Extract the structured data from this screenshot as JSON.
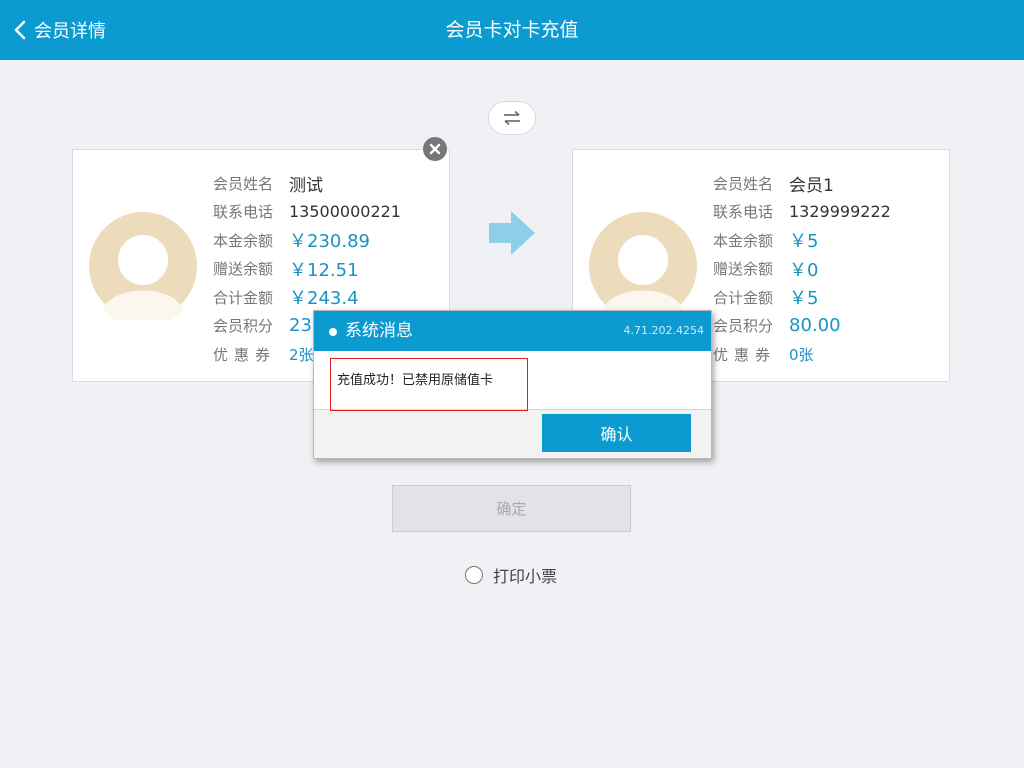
{
  "header": {
    "back_label": "会员详情",
    "title": "会员卡对卡充值"
  },
  "colors": {
    "primary": "#0b9bd0",
    "value_blue": "#1a93c4",
    "arrow": "#8ecfe8",
    "highlight_red": "#e02020"
  },
  "source_card": {
    "name_label": "会员姓名",
    "name": "测试",
    "phone_label": "联系电话",
    "phone": "13500000221",
    "principal_label": "本金余额",
    "principal": "￥230.89",
    "bonus_label": "赠送余额",
    "bonus": "￥12.51",
    "total_label": "合计金额",
    "total": "￥243.4",
    "points_label": "会员积分",
    "points": "23",
    "coupon_label": "优惠券",
    "coupons": "2张"
  },
  "target_card": {
    "name_label": "会员姓名",
    "name": "会员1",
    "phone_label": "联系电话",
    "phone": "1329999222",
    "principal_label": "本金余额",
    "principal": "￥5",
    "bonus_label": "赠送余额",
    "bonus": "￥0",
    "total_label": "合计金额",
    "total": "￥5",
    "points_label": "会员积分",
    "points": "80.00",
    "coupon_label": "优惠券",
    "coupons": "0张"
  },
  "confirm_label": "确定",
  "print_receipt_label": "打印小票",
  "dialog": {
    "title": "系统消息",
    "version": "4.71.202.4254",
    "message": "充值成功！已禁用原储值卡",
    "ok_label": "确认"
  },
  "icons": {
    "back": "chevron-left-icon",
    "swap": "swap-arrows-icon",
    "close": "close-circle-icon",
    "transfer": "arrow-right-icon",
    "avatar": "user-avatar-icon"
  }
}
